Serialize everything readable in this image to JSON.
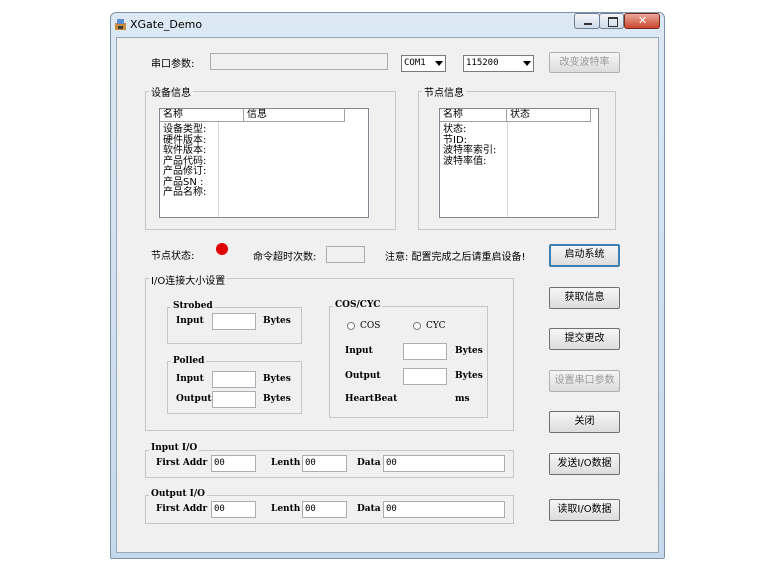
{
  "window": {
    "title": "XGate_Demo"
  },
  "serial": {
    "label": "串口参数:",
    "param_value": "",
    "port": "COM1",
    "baud": "115200",
    "change_baud_button": "改变波特率"
  },
  "device_info": {
    "group": "设备信息",
    "columns": [
      "名称",
      "信息"
    ],
    "rows": [
      "设备类型:",
      "硬件版本:",
      "软件版本:",
      "产品代码:",
      "产品修订:",
      "产品SN  :",
      "产品名称:"
    ]
  },
  "node_info": {
    "group": "节点信息",
    "columns": [
      "名称",
      "状态"
    ],
    "rows": [
      "状态:",
      "节ID:",
      "波特率索引:",
      "波特率值:"
    ]
  },
  "status": {
    "node_status_label": "节点状态:",
    "indicator_color": "#e00000",
    "timeout_label": "命令超时次数:",
    "timeout_value": "",
    "notice": "注意: 配置完成之后请重启设备!"
  },
  "io_size": {
    "group": "I/O连接大小设置",
    "strobed": {
      "group": "Strobed",
      "input_label": "Input",
      "input_value": "",
      "unit": "Bytes"
    },
    "polled": {
      "group": "Polled",
      "input_label": "Input",
      "input_value": "",
      "output_label": "Output",
      "output_value": "",
      "unit": "Bytes"
    },
    "cos_cyc": {
      "group": "COS/CYC",
      "cos_label": "COS",
      "cyc_label": "CYC",
      "input_label": "Input",
      "input_value": "",
      "output_label": "Output",
      "output_value": "",
      "unit": "Bytes",
      "heartbeat_label": "HeartBeat",
      "heartbeat_unit": "ms"
    }
  },
  "input_io": {
    "group": "Input I/O",
    "first_addr_label": "First Addr",
    "first_addr": "00",
    "length_label": "Lenth",
    "length": "00",
    "data_label": "Data",
    "data": "00"
  },
  "output_io": {
    "group": "Output I/O",
    "first_addr_label": "First Addr",
    "first_addr": "00",
    "length_label": "Lenth",
    "length": "00",
    "data_label": "Data",
    "data": "00"
  },
  "buttons": {
    "start": "启动系统",
    "get_info": "获取信息",
    "submit": "提交更改",
    "set_serial": "设置串口参数",
    "close": "关闭",
    "send_io": "发送I/O数据",
    "read_io": "读取I/O数据"
  }
}
